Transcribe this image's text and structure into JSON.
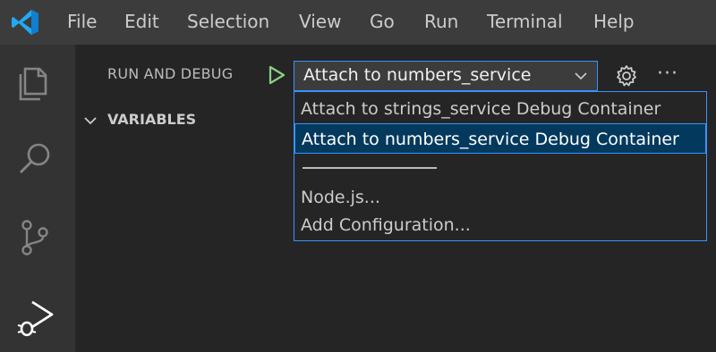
{
  "menu": [
    "File",
    "Edit",
    "Selection",
    "View",
    "Go",
    "Run",
    "Terminal",
    "Help"
  ],
  "activity_bar": {
    "icons": [
      "explorer-icon",
      "search-icon",
      "source-control-icon",
      "run-debug-icon"
    ],
    "active": "run-debug-icon"
  },
  "sidebar": {
    "title": "RUN AND DEBUG",
    "selected_config": "Attach to numbers_service",
    "more_label": "···"
  },
  "variables": {
    "label": "VARIABLES"
  },
  "dropdown": {
    "items": [
      "Attach to strings_service Debug Container",
      "Attach to numbers_service Debug Container",
      "Node.js...",
      "Add Configuration..."
    ],
    "selected_index": 1
  },
  "colors": {
    "accent": "#3794ff",
    "play": "#89d185",
    "selection_bg": "#04395e",
    "logo": "#23a9f2"
  }
}
